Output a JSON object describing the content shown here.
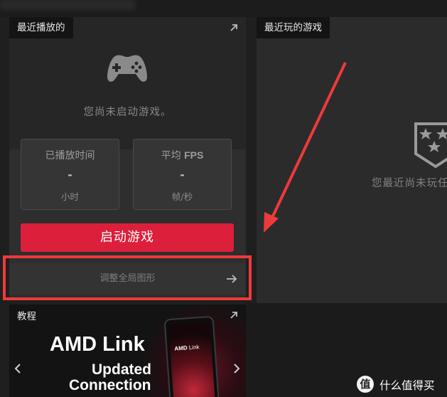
{
  "recent_played": {
    "title": "最近播放的",
    "empty_message": "您尚未启动游戏。",
    "stats": [
      {
        "label": "已播放时间",
        "value": "-",
        "unit": "小时"
      },
      {
        "label_prefix": "平均 ",
        "label_bold": "FPS",
        "value": "-",
        "unit": "帧/秒"
      }
    ],
    "launch_button": "启动游戏",
    "tune_graphics": "调整全局图形"
  },
  "recent_games": {
    "title": "最近玩的游戏",
    "empty_message": "您最近尚未玩任"
  },
  "tutorial": {
    "title": "教程",
    "headline": "AMD Link",
    "subline1": "Updated",
    "subline2": "Connection",
    "phone_brand": "AMD",
    "phone_brand_suffix": "Link"
  },
  "watermark": {
    "badge": "值",
    "text": "什么值得买"
  },
  "icons": {
    "controller": "gamepad-icon",
    "shield": "stars-shield-icon",
    "expand": "arrow-up-right-icon",
    "tune_arrow": "arrow-right-icon",
    "prev": "chevron-left-icon",
    "next": "chevron-right-icon"
  },
  "colors": {
    "accent": "#dc1f3b",
    "highlight": "#ee3a3a"
  }
}
